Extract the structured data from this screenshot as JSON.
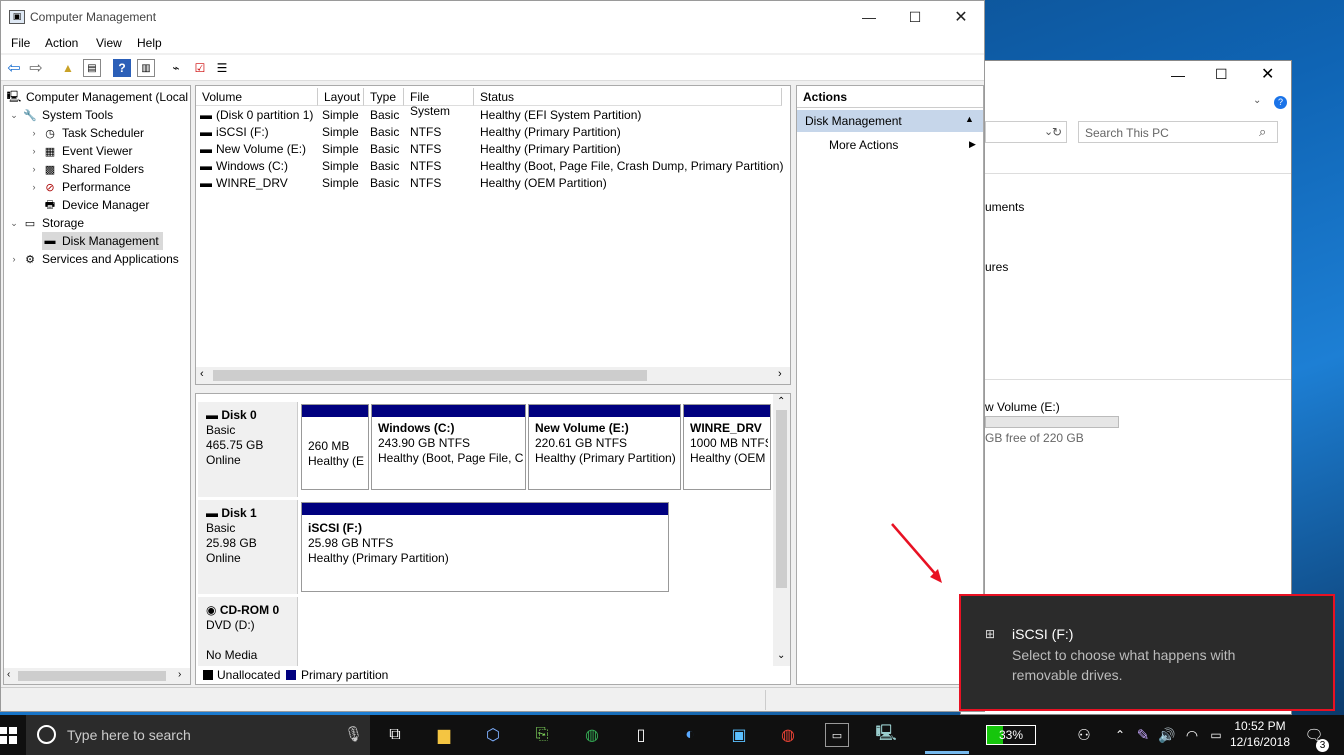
{
  "explorer": {
    "search_placeholder": "Search This PC",
    "item1": "uments",
    "item2": "ures",
    "drive_name": "w Volume (E:)",
    "drive_free": "GB free of 220 GB",
    "drive_fill_percent": 0
  },
  "window": {
    "title": "Computer Management"
  },
  "menu": [
    "File",
    "Action",
    "View",
    "Help"
  ],
  "tree": {
    "root": "Computer Management (Local",
    "system_tools": "System Tools",
    "task_scheduler": "Task Scheduler",
    "event_viewer": "Event Viewer",
    "shared_folders": "Shared Folders",
    "performance": "Performance",
    "device_manager": "Device Manager",
    "storage": "Storage",
    "disk_management": "Disk Management",
    "services": "Services and Applications"
  },
  "volumes": {
    "headers": [
      "Volume",
      "Layout",
      "Type",
      "File System",
      "Status"
    ],
    "rows": [
      [
        "(Disk 0 partition 1)",
        "Simple",
        "Basic",
        "",
        "Healthy (EFI System Partition)"
      ],
      [
        "iSCSI (F:)",
        "Simple",
        "Basic",
        "NTFS",
        "Healthy (Primary Partition)"
      ],
      [
        "New Volume (E:)",
        "Simple",
        "Basic",
        "NTFS",
        "Healthy (Primary Partition)"
      ],
      [
        "Windows (C:)",
        "Simple",
        "Basic",
        "NTFS",
        "Healthy (Boot, Page File, Crash Dump, Primary Partition)"
      ],
      [
        "WINRE_DRV",
        "Simple",
        "Basic",
        "NTFS",
        "Healthy (OEM Partition)"
      ]
    ]
  },
  "disks": {
    "disk0": {
      "name": "Disk 0",
      "type": "Basic",
      "size": "465.75 GB",
      "state": "Online"
    },
    "disk0_parts": [
      {
        "title": "",
        "size": "260 MB",
        "status": "Healthy (E"
      },
      {
        "title": "Windows  (C:)",
        "size": "243.90 GB NTFS",
        "status": "Healthy (Boot, Page File, C"
      },
      {
        "title": "New Volume  (E:)",
        "size": "220.61 GB NTFS",
        "status": "Healthy (Primary Partition)"
      },
      {
        "title": "WINRE_DRV",
        "size": "1000 MB NTFS",
        "status": "Healthy (OEM"
      }
    ],
    "disk1": {
      "name": "Disk 1",
      "type": "Basic",
      "size": "25.98 GB",
      "state": "Online"
    },
    "disk1_part": {
      "title": "iSCSI  (F:)",
      "size": "25.98 GB NTFS",
      "status": "Healthy (Primary Partition)"
    },
    "cdrom": {
      "name": "CD-ROM 0",
      "type": "DVD (D:)",
      "state": "No Media"
    },
    "legend_unallocated": "Unallocated",
    "legend_primary": "Primary partition"
  },
  "actions": {
    "title": "Actions",
    "section": "Disk Management",
    "more": "More Actions"
  },
  "toast": {
    "title": "iSCSI (F:)",
    "line1": "Select to choose what happens with",
    "line2": "removable drives."
  },
  "taskbar": {
    "search_placeholder": "Type here to search",
    "battery": "33%",
    "time": "10:52 PM",
    "date": "12/16/2018",
    "notifications": "3"
  },
  "colors": {
    "accent": "#00007f",
    "alert": "#e81123",
    "taskbar": "#101010"
  }
}
